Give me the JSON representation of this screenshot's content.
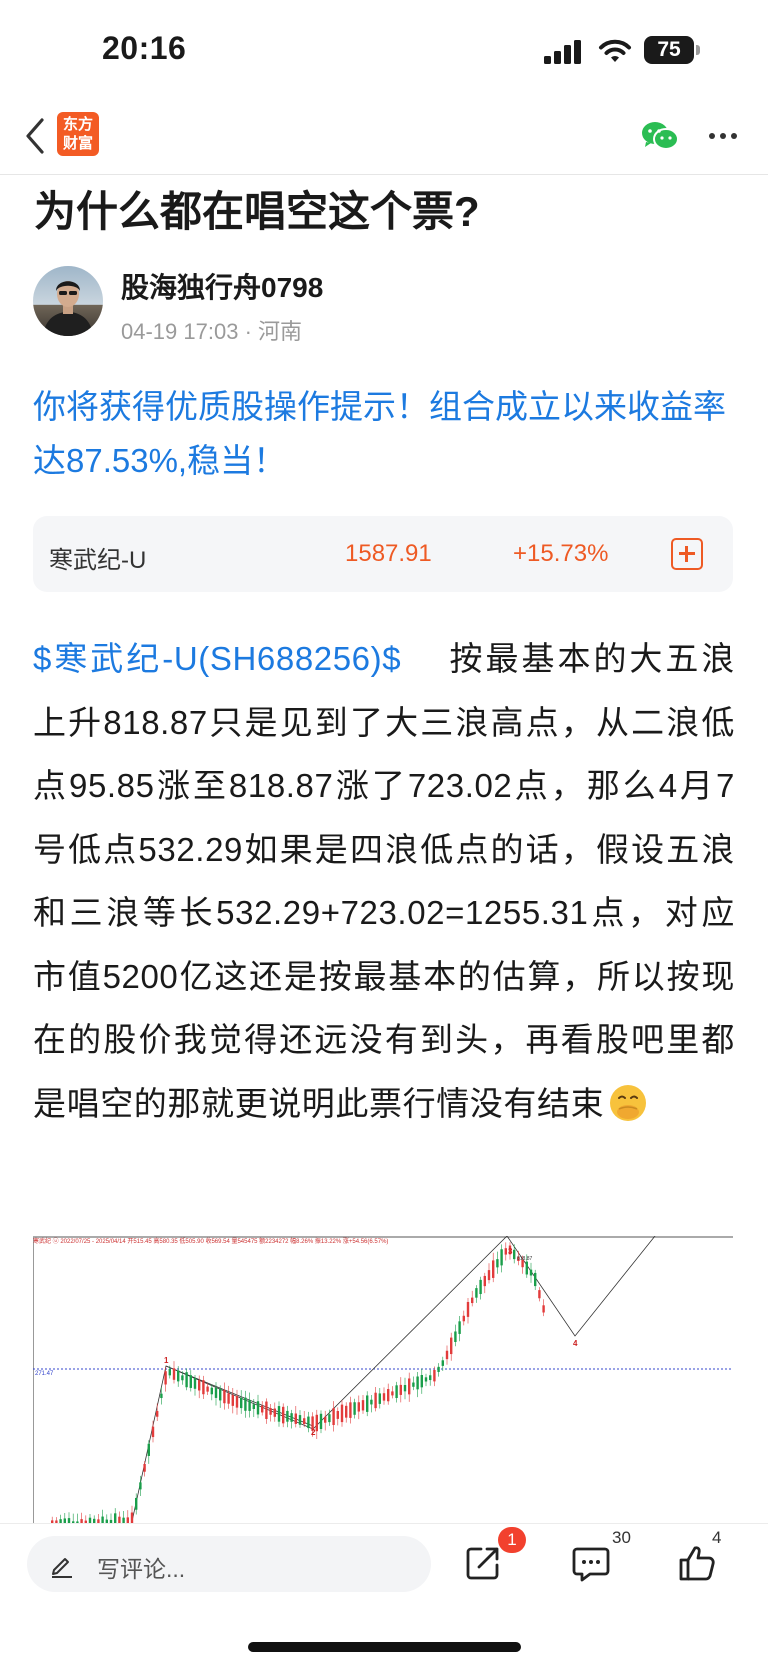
{
  "status": {
    "time": "20:16",
    "battery": "75"
  },
  "nav": {
    "logo_line1": "东方",
    "logo_line2": "财富",
    "back_icon": "chevron-left-icon",
    "share_icon": "wechat-icon",
    "more_icon": "more-icon"
  },
  "article": {
    "title": "为什么都在唱空这个票?",
    "author": "股海独行舟0798",
    "date": "04-19 17:03",
    "location": "河南",
    "promo": "你将获得优质股操作提示！组合成立以来收益率达87.53%,稳当！",
    "stock": {
      "name": "寒武纪-U",
      "price": "1587.91",
      "change": "+15.73%"
    },
    "stock_link": "$寒武纪-U(SH688256)$",
    "body": "按最基本的大五浪上升818.87只是见到了大三浪高点，从二浪低点95.85涨至818.87涨了723.02点，那么4月7号低点532.29如果是四浪低点的话，假设五浪和三浪等长532.29+723.02=1255.31点，对应市值5200亿这还是按最基本的估算，所以按现在的股价我觉得还远没有到头，再看股吧里都是唱空的那就更说明此票行情没有结束",
    "chart": {
      "header": "寒武纪 ⓤ 2022/07/25 - 2025/04/14  开515.45  高580.35  低505.90  收569.54  量545475  额2234272  幅8.26%  振13.22%  涨+54.56(6.57%)",
      "ref_label": "271.47",
      "wave_labels": [
        "1",
        "2",
        "3",
        "4"
      ],
      "peak_label": "818.87"
    }
  },
  "bottom": {
    "comment_placeholder": "写评论...",
    "share_badge": "1",
    "comment_count": "30",
    "like_count": "4"
  }
}
